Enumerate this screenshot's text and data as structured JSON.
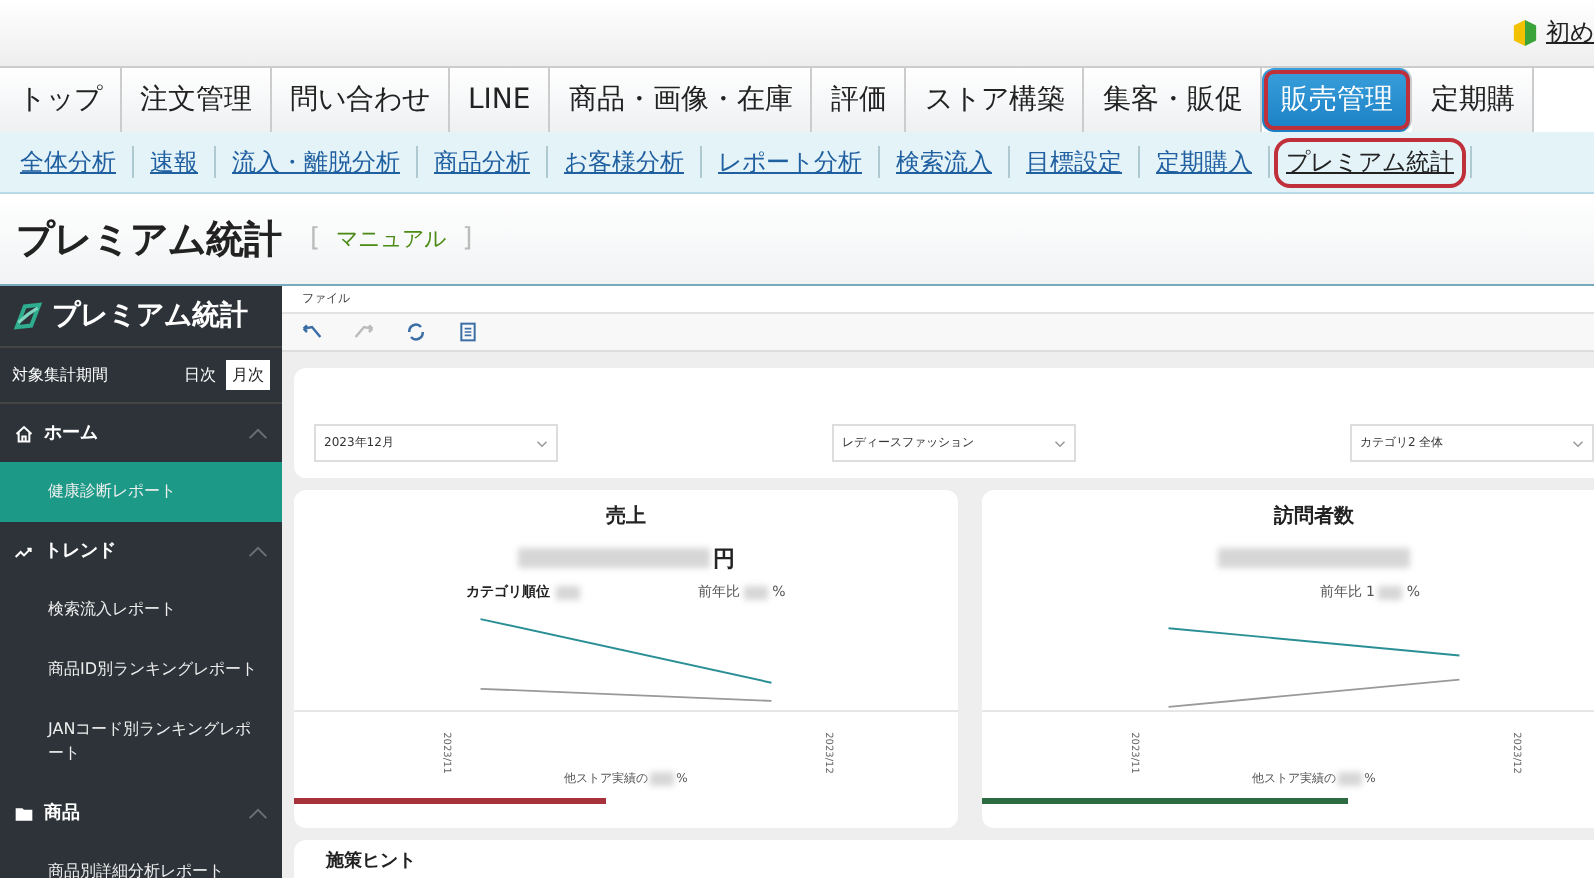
{
  "header": {
    "help_link": "初め"
  },
  "tabs": [
    {
      "label": "トップ",
      "selected": false
    },
    {
      "label": "注文管理",
      "selected": false
    },
    {
      "label": "問い合わせ",
      "selected": false
    },
    {
      "label": "LINE",
      "selected": false
    },
    {
      "label": "商品・画像・在庫",
      "selected": false
    },
    {
      "label": "評価",
      "selected": false
    },
    {
      "label": "ストア構築",
      "selected": false
    },
    {
      "label": "集客・販促",
      "selected": false
    },
    {
      "label": "販売管理",
      "selected": true
    },
    {
      "label": "定期購",
      "selected": false
    }
  ],
  "subnav": [
    {
      "label": "全体分析",
      "selected": false
    },
    {
      "label": "速報",
      "selected": false
    },
    {
      "label": "流入・離脱分析",
      "selected": false
    },
    {
      "label": "商品分析",
      "selected": false
    },
    {
      "label": "お客様分析",
      "selected": false
    },
    {
      "label": "レポート分析",
      "selected": false
    },
    {
      "label": "検索流入",
      "selected": false
    },
    {
      "label": "目標設定",
      "selected": false
    },
    {
      "label": "定期購入",
      "selected": false
    },
    {
      "label": "プレミアム統計",
      "selected": true
    }
  ],
  "page": {
    "title": "プレミアム統計",
    "bracket_open": "[",
    "manual_link": "マニュアル",
    "bracket_close": "]"
  },
  "sidebar": {
    "logo": "プレミアム統計",
    "period_label": "対象集計期間",
    "period_options": [
      {
        "label": "日次",
        "selected": false
      },
      {
        "label": "月次",
        "selected": true
      }
    ],
    "sections": [
      {
        "label": "ホーム",
        "kind": "home",
        "expanded": true,
        "children": [
          {
            "label": "健康診断レポート",
            "selected": true
          }
        ]
      },
      {
        "label": "トレンド",
        "kind": "trend",
        "expanded": true,
        "children": [
          {
            "label": "検索流入レポート",
            "selected": false
          },
          {
            "label": "商品ID別ランキングレポート",
            "selected": false
          },
          {
            "label": "JANコード別ランキングレポート",
            "selected": false
          }
        ]
      },
      {
        "label": "商品",
        "kind": "folder",
        "expanded": true,
        "children": [
          {
            "label": "商品別詳細分析レポート",
            "selected": false
          }
        ]
      }
    ]
  },
  "toolbar": {
    "menu_label": "ファイル"
  },
  "filters": [
    {
      "value": "2023年12月"
    },
    {
      "value": "レディースファッション"
    },
    {
      "value": "カテゴリ2 全体"
    }
  ],
  "cards": [
    {
      "title": "売上",
      "unit": "円",
      "rank_label": "カテゴリ順位",
      "yoy_label": "前年比",
      "percent": "%",
      "x_labels": [
        "2023/11",
        "2023/12"
      ],
      "share_label": "他ストア実績の",
      "share_percent": "%",
      "level": 0.47,
      "color": "#a8323c"
    },
    {
      "title": "訪問者数",
      "yoy_label": "前年比",
      "yoy_prefix": "1",
      "percent": "%",
      "x_labels": [
        "2023/11",
        "2023/12"
      ],
      "share_label": "他ストア実績の",
      "share_percent": "%",
      "level": 0.55,
      "color": "#2d6b43"
    }
  ],
  "next_section": {
    "title": "施策ヒント"
  }
}
